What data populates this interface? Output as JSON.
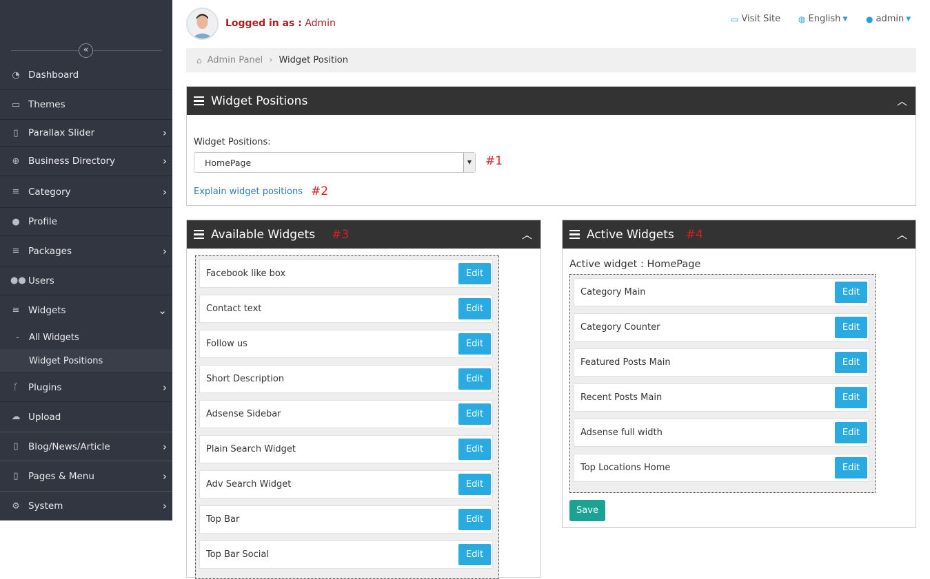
{
  "sidebar": {
    "items": [
      {
        "label": "Dashboard",
        "icon": "dashboard-icon"
      },
      {
        "label": "Themes",
        "icon": "desktop-icon"
      },
      {
        "label": "Parallax Slider",
        "icon": "file-icon"
      },
      {
        "label": "Business Directory",
        "icon": "plus-circle-icon"
      },
      {
        "label": "Category",
        "icon": "bars-icon"
      },
      {
        "label": "Profile",
        "icon": "user-icon"
      },
      {
        "label": "Packages",
        "icon": "bars-icon"
      },
      {
        "label": "Users",
        "icon": "users-icon"
      },
      {
        "label": "Widgets",
        "icon": "bars-icon"
      },
      {
        "label": "Plugins",
        "icon": "code-fork-icon"
      },
      {
        "label": "Upload",
        "icon": "cloud-upload-icon"
      },
      {
        "label": "Blog/News/Article",
        "icon": "file-icon"
      },
      {
        "label": "Pages & Menu",
        "icon": "file-icon"
      },
      {
        "label": "System",
        "icon": "gear-icon"
      }
    ],
    "sub": [
      "All Widgets",
      "Widget Positions"
    ]
  },
  "header": {
    "logged_label": "Logged in as :",
    "user": "Admin",
    "visit_site": "Visit Site",
    "language": "English",
    "account": "admin"
  },
  "breadcrumb": {
    "root": "Admin Panel",
    "current": "Widget Position"
  },
  "positions_panel": {
    "title": "Widget Positions",
    "field_label": "Widget Positions:",
    "selected": "HomePage",
    "link": "Explain widget positions",
    "tag1": "#1",
    "tag2": "#2"
  },
  "available_panel": {
    "title": "Available Widgets",
    "tag": "#3",
    "items": [
      "Facebook like box",
      "Contact text",
      "Follow us",
      "Short Description",
      "Adsense Sidebar",
      "Plain Search Widget",
      "Adv Search Widget",
      "Top Bar",
      "Top Bar Social"
    ]
  },
  "active_panel": {
    "title": "Active Widgets",
    "tag": "#4",
    "subtitle": "Active widget : HomePage",
    "items": [
      "Category Main",
      "Category Counter",
      "Featured Posts Main",
      "Recent Posts Main",
      "Adsense full width",
      "Top Locations Home"
    ],
    "save": "Save"
  },
  "edit_label": "Edit"
}
